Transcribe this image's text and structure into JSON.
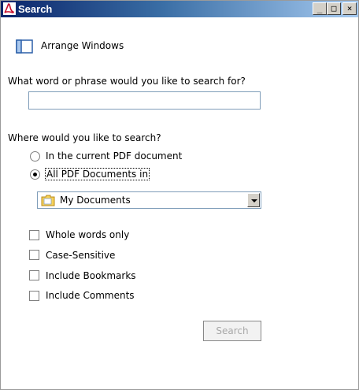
{
  "window": {
    "title": "Search",
    "minimize_label": "_",
    "maximize_label": "□",
    "close_label": "×"
  },
  "arrange": {
    "label": "Arrange Windows"
  },
  "search": {
    "prompt": "What word or phrase would you like to search for?",
    "value": "",
    "placeholder": ""
  },
  "scope": {
    "prompt": "Where would you like to search?",
    "options": [
      {
        "label": "In the current PDF document",
        "selected": false
      },
      {
        "label": "All PDF Documents in",
        "selected": true
      }
    ],
    "location": "My Documents"
  },
  "options": [
    {
      "label": "Whole words only",
      "checked": false
    },
    {
      "label": "Case-Sensitive",
      "checked": false
    },
    {
      "label": "Include Bookmarks",
      "checked": false
    },
    {
      "label": "Include Comments",
      "checked": false
    }
  ],
  "actions": {
    "search_label": "Search"
  },
  "colors": {
    "titlebar_start": "#0a246a",
    "titlebar_end": "#a6caf0",
    "disabled_text": "#a8a8a8"
  }
}
